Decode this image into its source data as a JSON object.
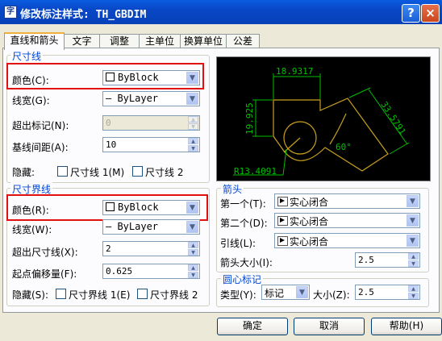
{
  "window": {
    "title": "修改标注样式: TH_GBDIM",
    "help": "?",
    "close": "×",
    "app_icon": "字"
  },
  "tabs": [
    "直线和箭头",
    "文字",
    "调整",
    "主单位",
    "换算单位",
    "公差"
  ],
  "dim_line": {
    "legend": "尺寸线",
    "color_label": "颜色(C):",
    "color_value": "ByBlock",
    "linewidth_label": "线宽(G):",
    "linewidth_value": "— ByLayer",
    "extend_label": "超出标记(N):",
    "extend_value": "0",
    "baseline_label": "基线间距(A):",
    "baseline_value": "10",
    "suppress_label": "隐藏:",
    "suppress_1": "尺寸线 1(M)",
    "suppress_2": "尺寸线 2"
  },
  "ext_line": {
    "legend": "尺寸界线",
    "color_label": "颜色(R):",
    "color_value": "ByBlock",
    "linewidth_label": "线宽(W):",
    "linewidth_value": "— ByLayer",
    "extend_label": "超出尺寸线(X):",
    "extend_value": "2",
    "offset_label": "起点偏移量(F):",
    "offset_value": "0.625",
    "suppress_label": "隐藏(S):",
    "suppress_1": "尺寸界线 1(E)",
    "suppress_2": "尺寸界线 2"
  },
  "arrows": {
    "legend": "箭头",
    "first_label": "第一个(T):",
    "first_value": "实心闭合",
    "second_label": "第二个(D):",
    "second_value": "实心闭合",
    "leader_label": "引线(L):",
    "leader_value": "实心闭合",
    "size_label": "箭头大小(I):",
    "size_value": "2.5"
  },
  "center_mark": {
    "legend": "圆心标记",
    "type_label": "类型(Y):",
    "type_value": "标记",
    "size_label": "大小(Z):",
    "size_value": "2.5"
  },
  "preview": {
    "dim_top": "18.9317",
    "dim_left": "19.925",
    "dim_diag": "33.5791",
    "angle": "60°",
    "radius": "R13.4091"
  },
  "buttons": {
    "ok": "确定",
    "cancel": "取消",
    "help": "帮助(H)"
  },
  "colors": {
    "title_bar": "#0a5ce0",
    "highlight": "#e01010",
    "preview_bg": "#000000",
    "dim_color": "#00c000",
    "geom_color": "#c8a020"
  }
}
